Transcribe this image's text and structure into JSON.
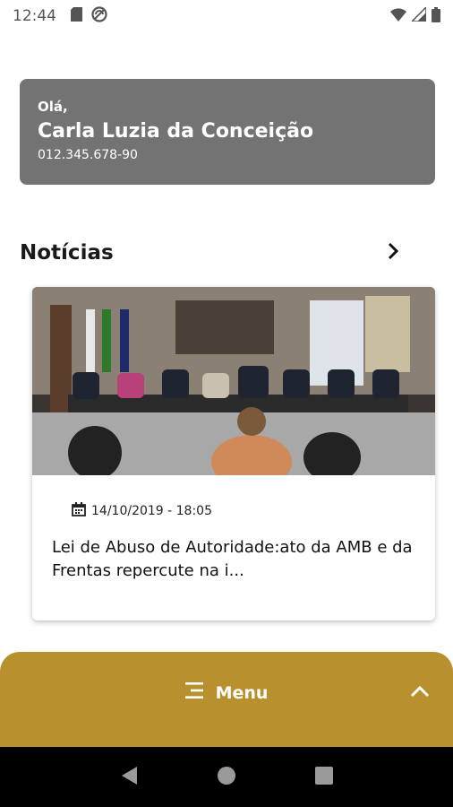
{
  "status": {
    "time": "12:44",
    "icons": [
      "sd-card-icon",
      "data-saver-icon",
      "wifi-icon",
      "signal-icon",
      "battery-icon"
    ]
  },
  "user": {
    "greeting": "Olá,",
    "name": "Carla Luzia da Conceição",
    "cpf": "012.345.678-90"
  },
  "news": {
    "section_title": "Notícias",
    "items": [
      {
        "date": "14/10/2019 - 18:05",
        "headline": "Lei de Abuso de Autoridade:ato da AMB e da Frentas repercute na i..."
      }
    ]
  },
  "menu": {
    "label": "Menu"
  },
  "colors": {
    "accent": "#B8912E",
    "card_gray": "#737373",
    "nav_bar": "#000000"
  }
}
